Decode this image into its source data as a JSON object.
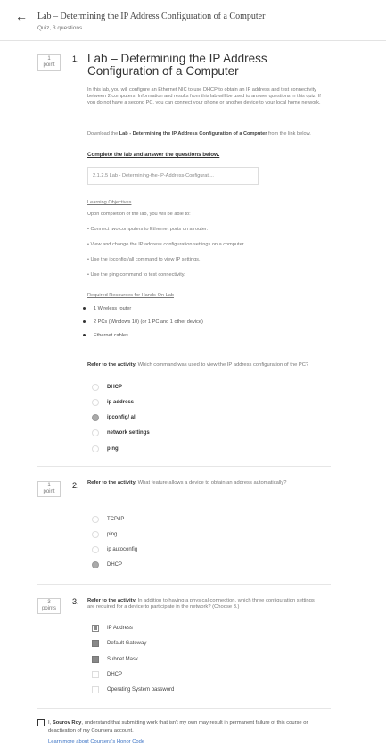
{
  "header": {
    "back_icon": "arrow-left-icon",
    "title": "Lab – Determining the IP Address Configuration of a Computer",
    "subtitle": "Quiz, 3 questions"
  },
  "q1": {
    "points": "1",
    "points_word": "point",
    "number": "1.",
    "title": "Lab – Determining the IP Address Configuration of a Computer",
    "intro": "In this lab, you will configure an Ethernet NIC to use DHCP to obtain an IP address and test connectivity between 2 computers. Information and results from this lab will be used to answer questions in this quiz. If you do not have a second PC, you can connect your phone or another device to your local home network.",
    "download_prefix": "Download the ",
    "download_bold": "Lab - Determining the IP Address Configuration of a Computer",
    "download_suffix": " from the link below.",
    "complete": "Complete the lab and answer the questions below.",
    "file": "2.1.2.5 Lab - Determining-the-IP-Address-Configurati...",
    "objectives_heading": "Learning Objectives",
    "objectives_intro": "Upon completion of the lab, you will be able to:",
    "objectives": [
      "• Connect two computers to Ethernet ports on a router.",
      "• View and change the IP address configuration settings on a computer.",
      "• Use the ipconfig /all command to view IP settings.",
      "• Use the ping command to test connectivity."
    ],
    "resources_heading": "Required Resources for Hands-On Lab",
    "resources": [
      "1 Wireless router",
      "2 PCs (Windows 10) (or 1 PC and 1 other device)",
      "Ethernet cables"
    ],
    "prompt_bold": "Refer to the activity.",
    "prompt": " Which command was used to view the IP address configuration of the PC?",
    "options": [
      "DHCP",
      "ip address",
      "ipconfig/ all",
      "network settings",
      "ping"
    ],
    "selected_index": 2
  },
  "q2": {
    "points": "1",
    "points_word": "point",
    "number": "2.",
    "prompt_bold": "Refer to the activity.",
    "prompt": " What feature allows a device to obtain an address automatically?",
    "options": [
      "TCP/IP",
      "ping",
      "ip autoconfig",
      "DHCP"
    ],
    "selected_index": 3
  },
  "q3": {
    "points": "3",
    "points_word": "points",
    "number": "3.",
    "prompt_bold": "Refer to the activity.",
    "prompt": " In addition to having a physical connection, which three configuration settings are required for a device to participate in the network? (Choose 3.)",
    "options": [
      "IP Address",
      "Default Gateway",
      "Subnet Mask",
      "DHCP",
      "Operating System password"
    ],
    "checked": [
      true,
      true,
      true,
      false,
      false
    ]
  },
  "honor": {
    "prefix": "I, ",
    "name": "Sourov Roy",
    "text": ", understand that submitting work that isn't my own may result in permanent failure of this course or deactivation of my Coursera account.",
    "link": "Learn more about Coursera's Honor Code"
  }
}
